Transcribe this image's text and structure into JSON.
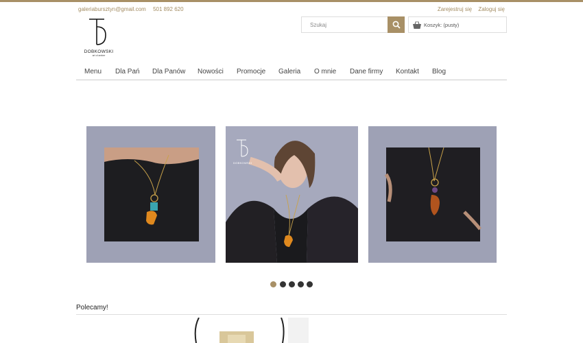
{
  "contact": {
    "email": "galeriabursztyn@gmail.com",
    "phone": "501 892 620"
  },
  "account": {
    "register": "Zarejestruj się",
    "login": "Zaloguj się"
  },
  "logo": {
    "name": "DOBKOWSKI",
    "tagline": "art of amber",
    "slide_mark": "DOBKOWSKI"
  },
  "search": {
    "placeholder": "Szukaj"
  },
  "cart": {
    "label": "Koszyk:",
    "status": "(pusty)"
  },
  "nav": [
    "Menu",
    "Dla Pań",
    "Dla Panów",
    "Nowości",
    "Promocje",
    "Galeria",
    "O mnie",
    "Dane firmy",
    "Kontakt",
    "Blog"
  ],
  "slider": {
    "active_dot": 0,
    "dot_count": 5
  },
  "recommended": {
    "title": "Polecamy!"
  },
  "colors": {
    "accent": "#a89066",
    "slide_bg": "#9ea1b5",
    "dot": "#333333"
  }
}
